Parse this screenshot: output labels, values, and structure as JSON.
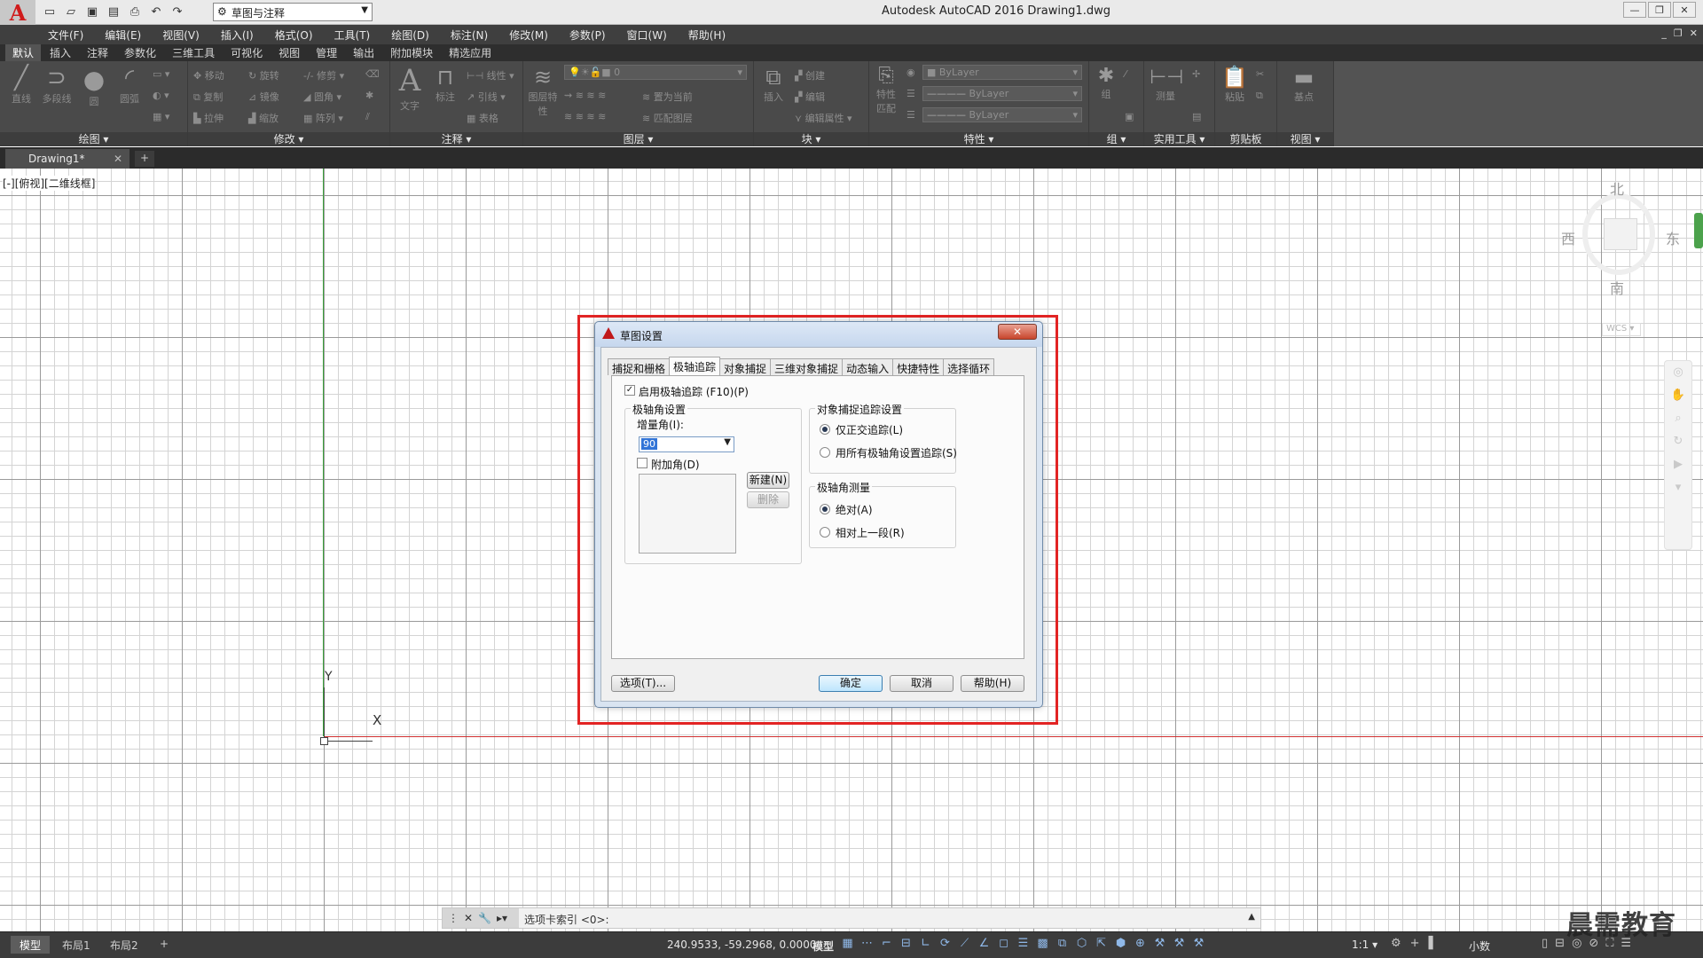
{
  "titlebar": {
    "app_logo": "A",
    "workspace": "草图与注释",
    "app_title": "Autodesk AutoCAD 2016     Drawing1.dwg",
    "qat_icons": [
      "new-icon",
      "open-icon",
      "save-icon",
      "saveas-icon",
      "print-icon",
      "undo-icon",
      "redo-icon"
    ]
  },
  "menubar": {
    "items": [
      "文件(F)",
      "编辑(E)",
      "视图(V)",
      "插入(I)",
      "格式(O)",
      "工具(T)",
      "绘图(D)",
      "标注(N)",
      "修改(M)",
      "参数(P)",
      "窗口(W)",
      "帮助(H)"
    ]
  },
  "ribbon_tabs": [
    "默认",
    "插入",
    "注释",
    "参数化",
    "三维工具",
    "可视化",
    "视图",
    "管理",
    "输出",
    "附加模块",
    "精选应用"
  ],
  "ribbon": {
    "draw": {
      "footer": "绘图 ▾",
      "tools": [
        "直线",
        "多段线",
        "圆",
        "圆弧"
      ]
    },
    "modify": {
      "footer": "修改 ▾",
      "tools": [
        "移动",
        "旋转",
        "修剪",
        "复制",
        "镜像",
        "圆角",
        "拉伸",
        "缩放",
        "阵列"
      ]
    },
    "annotation": {
      "footer": "注释 ▾",
      "tools": [
        "文字",
        "标注",
        "线性",
        "引线",
        "表格"
      ]
    },
    "layers": {
      "footer": "图层 ▾",
      "tools": [
        "图层特性",
        "置为当前",
        "匹配图层"
      ],
      "layer_value": "0"
    },
    "block": {
      "footer": "块 ▾",
      "tools": [
        "插入",
        "创建",
        "编辑",
        "编辑属性"
      ]
    },
    "properties": {
      "footer": "特性 ▾",
      "tools": [
        "特性匹配"
      ],
      "color": "ByLayer",
      "linetype": "ByLayer",
      "lineweight": "ByLayer"
    },
    "groups": {
      "footer": "组 ▾",
      "tools": [
        "组"
      ]
    },
    "utilities": {
      "footer": "实用工具 ▾",
      "tools": [
        "测量"
      ]
    },
    "clipboard": {
      "footer": "剪贴板",
      "tools": [
        "粘贴"
      ]
    },
    "view": {
      "footer": "视图 ▾",
      "tools": [
        "基点"
      ]
    }
  },
  "file_tabs": {
    "active": "Drawing1*",
    "plus": "+"
  },
  "canvas": {
    "viewport_label": "[-][俯视][二维线框]",
    "ucs_y": "Y",
    "ucs_x": "X",
    "viewcube": {
      "north": "北",
      "south": "南",
      "west": "西",
      "east": "东",
      "wcs": "WCS ▾"
    }
  },
  "dialog": {
    "title": "草图设置",
    "close": "✕",
    "tabs": [
      "捕捉和栅格",
      "极轴追踪",
      "对象捕捉",
      "三维对象捕捉",
      "动态输入",
      "快捷特性",
      "选择循环"
    ],
    "active_tab": "极轴追踪",
    "enable_polar": {
      "label": "启用极轴追踪 (F10)(P)",
      "checked": "✓"
    },
    "polar_angle_group": "极轴角设置",
    "increment_label": "增量角(I):",
    "increment_value": "90",
    "additional_angle": "附加角(D)",
    "new_button": "新建(N)",
    "delete_button": "删除",
    "osnap_group": "对象捕捉追踪设置",
    "osnap_ortho": "仅正交追踪(L)",
    "osnap_all": "用所有极轴角设置追踪(S)",
    "measure_group": "极轴角测量",
    "measure_absolute": "绝对(A)",
    "measure_relative": "相对上一段(R)",
    "options_button": "选项(T)...",
    "ok_button": "确定",
    "cancel_button": "取消",
    "help_button": "帮助(H)"
  },
  "cmdline": {
    "text": "选项卡索引 <0>:"
  },
  "statusbar": {
    "layout_tabs": [
      "模型",
      "布局1",
      "布局2"
    ],
    "plus": "+",
    "coords": "240.9533, -59.2968, 0.0000",
    "model": "模型",
    "scale": "1:1 ▾",
    "units": "小数"
  },
  "watermark": "晨需教育",
  "colors": {
    "accent_red": "#e22424",
    "axis_x": "#d03030",
    "axis_y": "#3aa03a",
    "ribbon_bg": "#4a4a4a"
  }
}
